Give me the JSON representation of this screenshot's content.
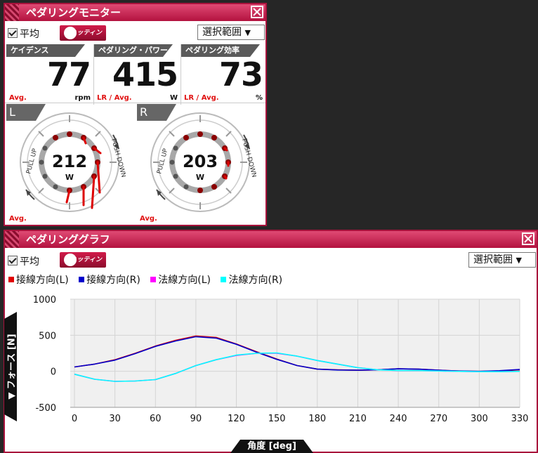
{
  "monitor": {
    "title": "ペダリングモニター",
    "average_label": "平均",
    "fitting_label": "フィッティング",
    "range_select": "選択範囲",
    "dropdown_arrow": "▼",
    "metrics": [
      {
        "header": "ケイデンス",
        "value": "77",
        "avg": "Avg.",
        "unit": "rpm"
      },
      {
        "header": "ペダリング・パワー",
        "value": "415",
        "avg": "LR / Avg.",
        "unit": "W"
      },
      {
        "header": "ペダリング効率",
        "value": "73",
        "avg": "LR / Avg.",
        "unit": "%"
      }
    ],
    "left": {
      "side": "L",
      "value": "212",
      "unit": "W",
      "avg": "Avg.",
      "pull_up": "PULL UP",
      "push_down": "PUSH DOWN"
    },
    "right": {
      "side": "R",
      "value": "203",
      "unit": "W",
      "avg": "Avg.",
      "pull_up": "PULL UP",
      "push_down": "PUSH DOWN"
    }
  },
  "graph_panel": {
    "title": "ペダリンググラフ",
    "average_label": "平均",
    "fitting_label": "フィッティング",
    "range_select": "選択範囲",
    "dropdown_arrow": "▼",
    "y_axis_label": "▼ フォース [N]",
    "x_axis_label": "角度 [deg]"
  },
  "colors": {
    "accent": "#b3123f",
    "tangential_l": "#e00000",
    "tangential_r": "#0000cc",
    "normal_l": "#ff00ff",
    "normal_r": "#00ffff"
  },
  "chart_data": {
    "type": "line",
    "xlabel": "角度 [deg]",
    "ylabel": "▼ フォース [N]",
    "xlim": [
      0,
      330
    ],
    "ylim": [
      -500,
      1000
    ],
    "xticks": [
      0,
      30,
      60,
      90,
      120,
      150,
      180,
      210,
      240,
      270,
      300,
      330
    ],
    "yticks": [
      1000,
      500,
      0,
      -500
    ],
    "grid": true,
    "legend_position": "top-left",
    "x": [
      0,
      15,
      30,
      45,
      60,
      75,
      90,
      105,
      120,
      135,
      150,
      165,
      180,
      195,
      210,
      225,
      240,
      255,
      270,
      285,
      300,
      315,
      330
    ],
    "series": [
      {
        "name": "接線方向(L)",
        "color": "#e00000",
        "values": [
          60,
          100,
          160,
          250,
          350,
          430,
          490,
          470,
          380,
          270,
          170,
          80,
          30,
          20,
          15,
          20,
          35,
          30,
          15,
          5,
          0,
          5,
          20
        ]
      },
      {
        "name": "接線方向(R)",
        "color": "#0000cc",
        "values": [
          60,
          100,
          155,
          245,
          345,
          420,
          480,
          460,
          375,
          265,
          165,
          80,
          30,
          18,
          15,
          20,
          35,
          30,
          15,
          5,
          0,
          8,
          25
        ]
      },
      {
        "name": "法線方向(L)",
        "color": "#ff00ff",
        "values": [
          -40,
          -110,
          -140,
          -135,
          -115,
          -30,
          80,
          160,
          220,
          250,
          250,
          210,
          150,
          100,
          50,
          20,
          10,
          10,
          5,
          0,
          -5,
          -5,
          0
        ]
      },
      {
        "name": "法線方向(R)",
        "color": "#00ffff",
        "values": [
          -40,
          -110,
          -140,
          -135,
          -115,
          -30,
          80,
          160,
          225,
          250,
          255,
          210,
          150,
          100,
          50,
          20,
          10,
          10,
          5,
          0,
          -5,
          -5,
          0
        ]
      }
    ]
  }
}
